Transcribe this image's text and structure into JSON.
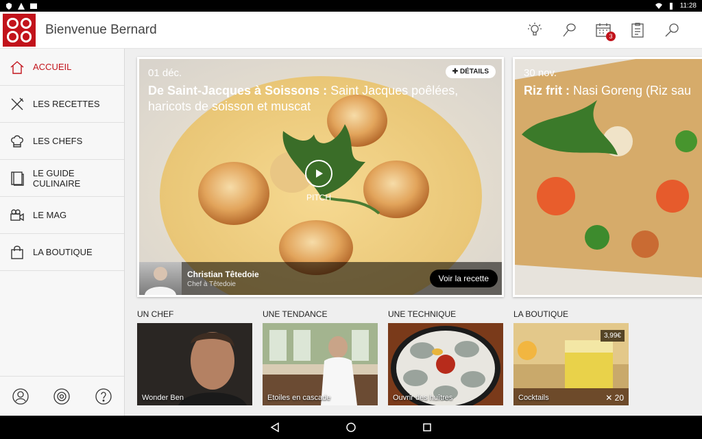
{
  "status_bar": {
    "time": "11:28"
  },
  "app_bar": {
    "welcome": "Bienvenue Bernard",
    "icons": [
      "lightbulb-icon",
      "whisk-icon",
      "calendar-icon",
      "clipboard-icon",
      "search-icon"
    ],
    "calendar_badge": "3"
  },
  "sidebar": {
    "items": [
      {
        "label": "ACCUEIL",
        "icon": "home-icon",
        "active": true
      },
      {
        "label": "LES RECETTES",
        "icon": "utensils-icon"
      },
      {
        "label": "LES CHEFS",
        "icon": "chef-hat-icon"
      },
      {
        "label": "LE GUIDE CULINAIRE",
        "icon": "book-icon"
      },
      {
        "label": "LE MAG",
        "icon": "video-camera-icon"
      },
      {
        "label": "LA BOUTIQUE",
        "icon": "shopping-bag-icon"
      }
    ],
    "bottom_icons": [
      "profile-icon",
      "settings-icon",
      "help-icon"
    ]
  },
  "featured": [
    {
      "date": "01 déc.",
      "title_bold": "De Saint-Jacques à Soissons :",
      "title_rest": " Saint Jacques poêlées, haricots de soisson et muscat",
      "details_label": "DÉTAILS",
      "play_label": "PITCH",
      "chef_name": "Christian Têtedoie",
      "chef_role": "Chef à Têtedoie",
      "cta_label": "Voir la recette"
    },
    {
      "date": "30 nov.",
      "title_bold": "Riz frit :",
      "title_rest": " Nasi Goreng (Riz sau"
    }
  ],
  "sections": [
    {
      "title": "UN CHEF",
      "label": "Wonder Ben"
    },
    {
      "title": "UNE TENDANCE",
      "label": "Etoiles en cascade"
    },
    {
      "title": "UNE TECHNIQUE",
      "label": "Ouvrir des huîtres"
    },
    {
      "title": "LA BOUTIQUE",
      "label": "Cocktails",
      "price": "3,99€",
      "likes": "20"
    }
  ],
  "colors": {
    "brand": "#c2131b"
  }
}
